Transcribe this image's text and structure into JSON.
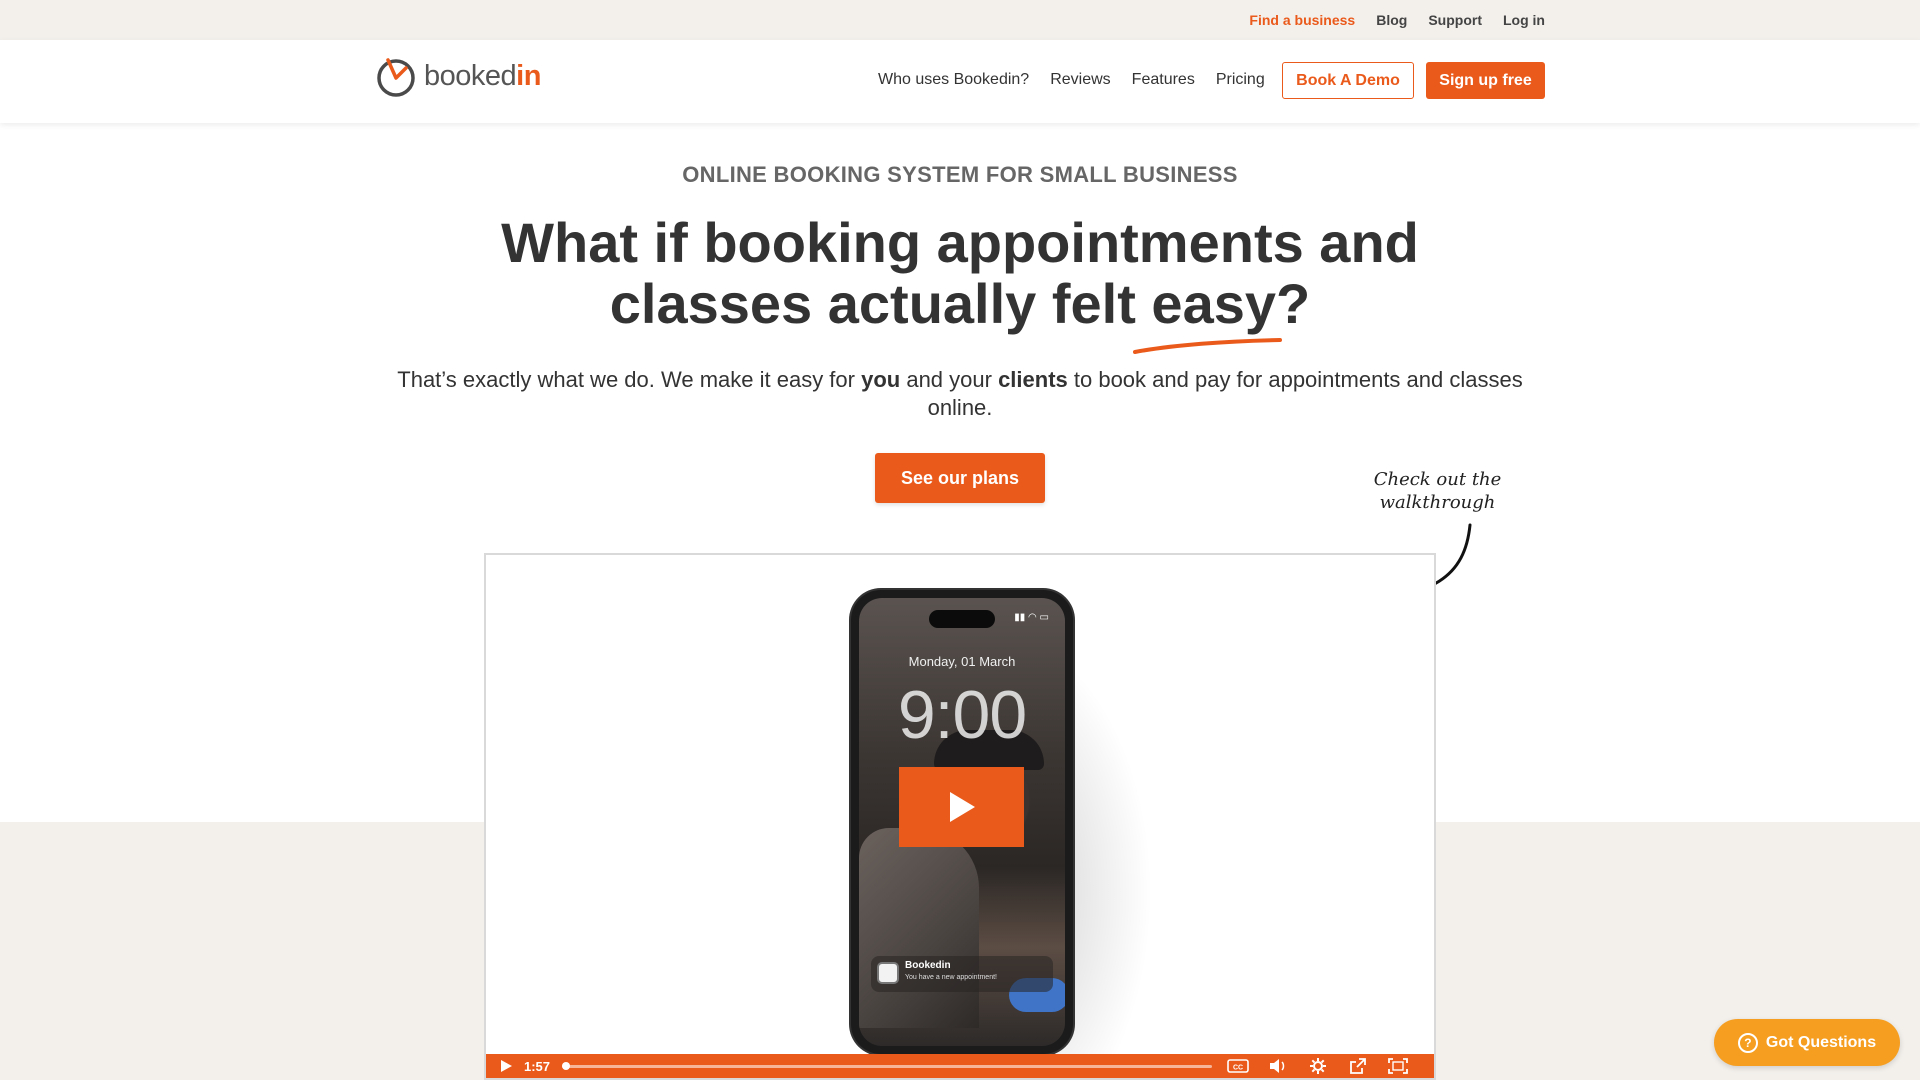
{
  "topbar": {
    "links": [
      {
        "label": "Find a business"
      },
      {
        "label": "Blog"
      },
      {
        "label": "Support"
      },
      {
        "label": "Log in"
      }
    ]
  },
  "header": {
    "logo_text_main": "booked",
    "logo_text_accent": "in",
    "nav": [
      {
        "label": "Who uses Bookedin?"
      },
      {
        "label": "Reviews"
      },
      {
        "label": "Features"
      },
      {
        "label": "Pricing"
      }
    ],
    "demo_label": "Book A Demo",
    "signup_label": "Sign up free"
  },
  "hero": {
    "eyebrow": "ONLINE BOOKING SYSTEM FOR SMALL BUSINESS",
    "headline_line1": "What if booking appointments and",
    "headline_line2_pre": "classes actually felt ",
    "headline_emph": "easy",
    "headline_end": "?",
    "sub_1": "That’s exactly what we do. We make it easy for ",
    "sub_you": "you",
    "sub_2": " and your ",
    "sub_clients": "clients",
    "sub_3": " to book and pay for appointments and classes online.",
    "cta_label": "See our plans",
    "note_line1": "Check out the",
    "note_line2": "walkthrough"
  },
  "video": {
    "lock_date": "Monday, 01 March",
    "lock_time": "9:00",
    "notif_title": "Bookedin",
    "notif_text": "You have a new appointment!",
    "duration": "1:57",
    "progress": 0
  },
  "chat": {
    "label": "Got Questions"
  },
  "colors": {
    "accent": "#ea5a1b",
    "chat": "#f59e20",
    "band": "#f3f0ec"
  }
}
